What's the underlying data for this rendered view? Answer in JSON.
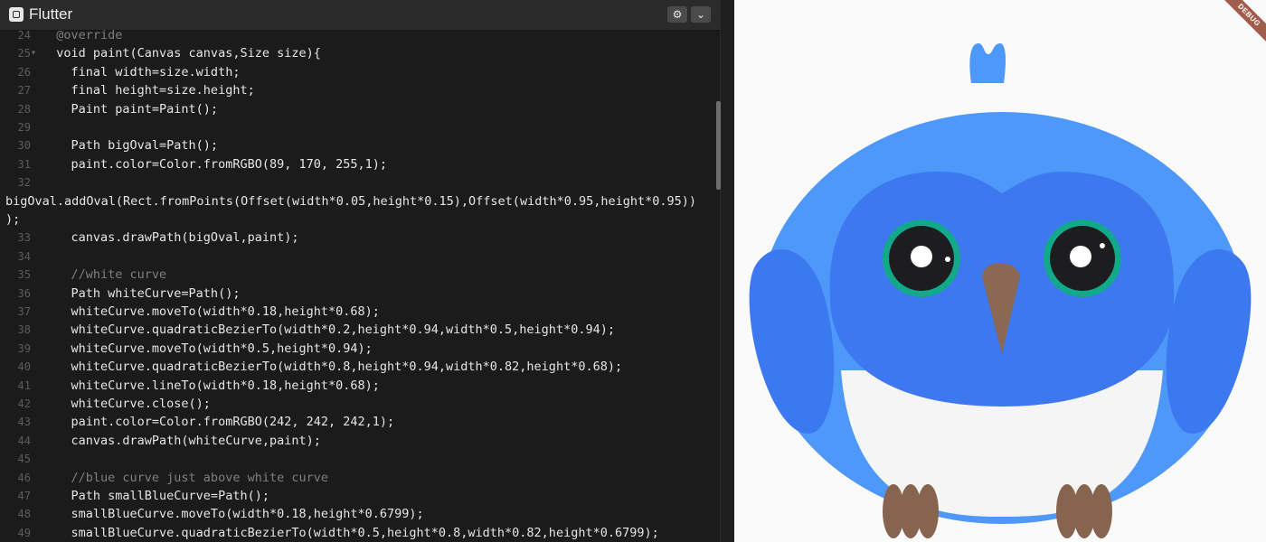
{
  "app": {
    "title": "Flutter"
  },
  "toolbar": {
    "settings_icon": "gear-icon",
    "menu_icon": "chevron-down-icon"
  },
  "editor": {
    "lines": [
      {
        "num": "24",
        "fold": "",
        "text": "  @override"
      },
      {
        "num": "25",
        "fold": "▾",
        "text": "  void paint(Canvas canvas,Size size){"
      },
      {
        "num": "26",
        "fold": "",
        "text": "    final width=size.width;"
      },
      {
        "num": "27",
        "fold": "",
        "text": "    final height=size.height;"
      },
      {
        "num": "28",
        "fold": "",
        "text": "    Paint paint=Paint();"
      },
      {
        "num": "29",
        "fold": "",
        "text": ""
      },
      {
        "num": "30",
        "fold": "",
        "text": "    Path bigOval=Path();"
      },
      {
        "num": "31",
        "fold": "",
        "text": "    paint.color=Color.fromRGBO(89, 170, 255,1);"
      },
      {
        "num": "32",
        "fold": "",
        "text": ""
      },
      {
        "num": "",
        "fold": "",
        "text": "bigOval.addOval(Rect.fromPoints(Offset(width*0.05,height*0.15),Offset(width*0.95,height*0.95))"
      },
      {
        "num": "",
        "fold": "",
        "text": ");"
      },
      {
        "num": "33",
        "fold": "",
        "text": "    canvas.drawPath(bigOval,paint);"
      },
      {
        "num": "34",
        "fold": "",
        "text": ""
      },
      {
        "num": "35",
        "fold": "",
        "text": "    //white curve"
      },
      {
        "num": "36",
        "fold": "",
        "text": "    Path whiteCurve=Path();"
      },
      {
        "num": "37",
        "fold": "",
        "text": "    whiteCurve.moveTo(width*0.18,height*0.68);"
      },
      {
        "num": "38",
        "fold": "",
        "text": "    whiteCurve.quadraticBezierTo(width*0.2,height*0.94,width*0.5,height*0.94);"
      },
      {
        "num": "39",
        "fold": "",
        "text": "    whiteCurve.moveTo(width*0.5,height*0.94);"
      },
      {
        "num": "40",
        "fold": "",
        "text": "    whiteCurve.quadraticBezierTo(width*0.8,height*0.94,width*0.82,height*0.68);"
      },
      {
        "num": "41",
        "fold": "",
        "text": "    whiteCurve.lineTo(width*0.18,height*0.68);"
      },
      {
        "num": "42",
        "fold": "",
        "text": "    whiteCurve.close();"
      },
      {
        "num": "43",
        "fold": "",
        "text": "    paint.color=Color.fromRGBO(242, 242, 242,1);"
      },
      {
        "num": "44",
        "fold": "",
        "text": "    canvas.drawPath(whiteCurve,paint);"
      },
      {
        "num": "45",
        "fold": "",
        "text": ""
      },
      {
        "num": "46",
        "fold": "",
        "text": "    //blue curve just above white curve"
      },
      {
        "num": "47",
        "fold": "",
        "text": "    Path smallBlueCurve=Path();"
      },
      {
        "num": "48",
        "fold": "",
        "text": "    smallBlueCurve.moveTo(width*0.18,height*0.6799);"
      },
      {
        "num": "49",
        "fold": "",
        "text": "    smallBlueCurve.quadraticBezierTo(width*0.5,height*0.8,width*0.82,height*0.6799);"
      }
    ]
  },
  "preview": {
    "debug_label": "DEBUG",
    "colors": {
      "body": "#4e98fa",
      "face": "#3d78f0",
      "wing": "#3c78ef",
      "white": "#f5f5f5",
      "eye_ring": "#12a88a",
      "pupil": "#1d1d1f",
      "beak": "#8a6853",
      "feet": "#876450"
    }
  }
}
